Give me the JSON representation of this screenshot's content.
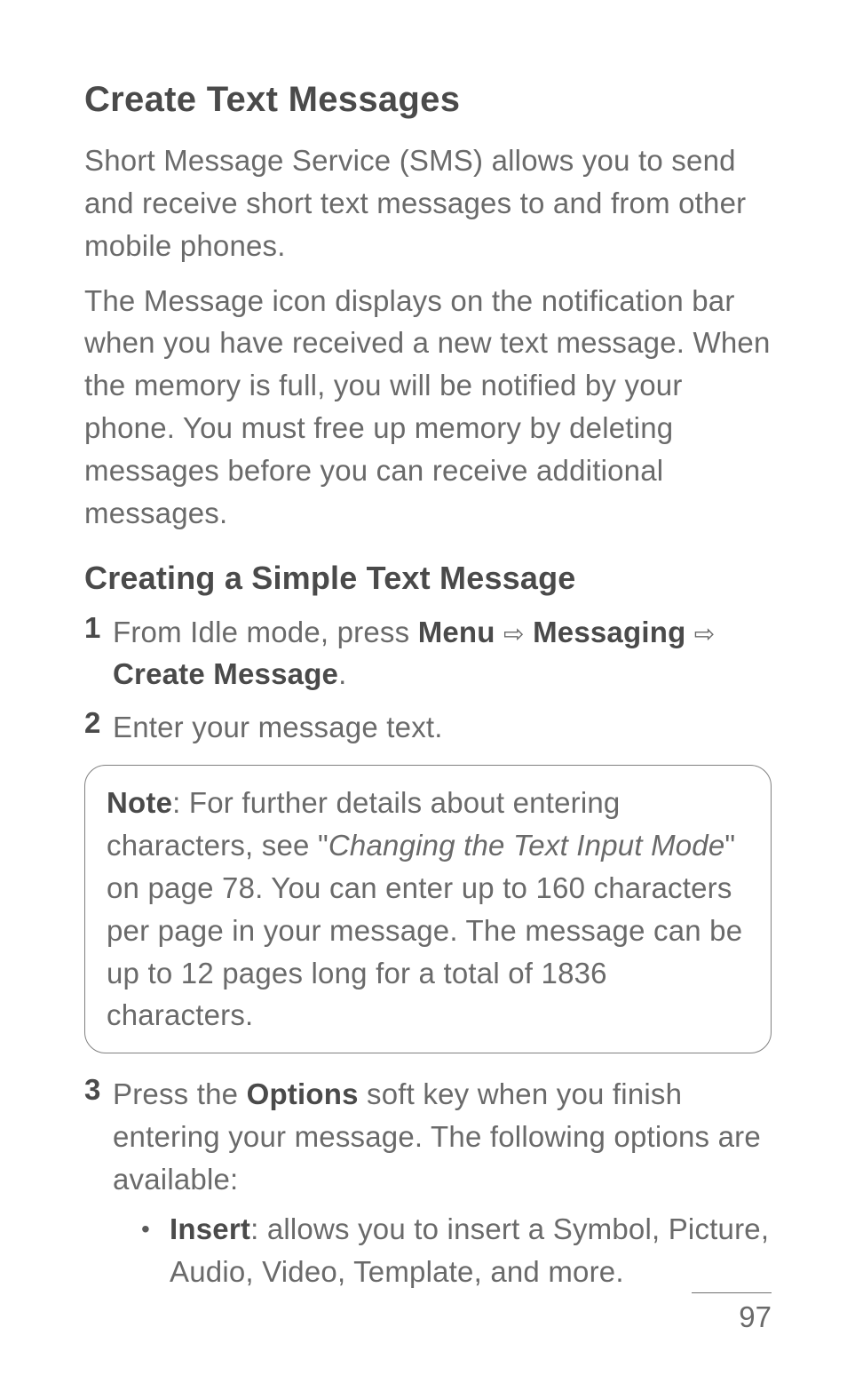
{
  "heading1": "Create Text Messages",
  "para1": "Short Message Service (SMS) allows you to send and receive short text messages to and from other mobile phones.",
  "para2": "The Message icon displays on the notification bar when you have received a new text message. When the memory is full, you will be notified by your phone. You must free up memory by deleting messages before you can receive additional messages.",
  "heading2": "Creating a Simple Text Message",
  "step1": {
    "num": "1",
    "pre": "From Idle mode, press ",
    "menu": "Menu",
    "messaging": "Messaging",
    "create": "Create Message",
    "period": "."
  },
  "step2": {
    "num": "2",
    "text": "Enter your message text."
  },
  "note": {
    "label": "Note",
    "pre": ": For further details about entering characters, see \"",
    "italic": "Changing the Text Input Mode",
    "post": "\" on page 78. You can enter up to 160 characters per page in your message. The message can be up to 12 pages long for a total of 1836 characters."
  },
  "step3": {
    "num": "3",
    "pre": "Press the ",
    "options": "Options",
    "post": " soft key when you finish entering your message. The following options are available:"
  },
  "bullet1": {
    "label": "Insert",
    "text": ": allows you to insert a Symbol, Picture, Audio, Video, Template, and more."
  },
  "arrow": "⇨",
  "bulletChar": "•",
  "pageNum": "97"
}
